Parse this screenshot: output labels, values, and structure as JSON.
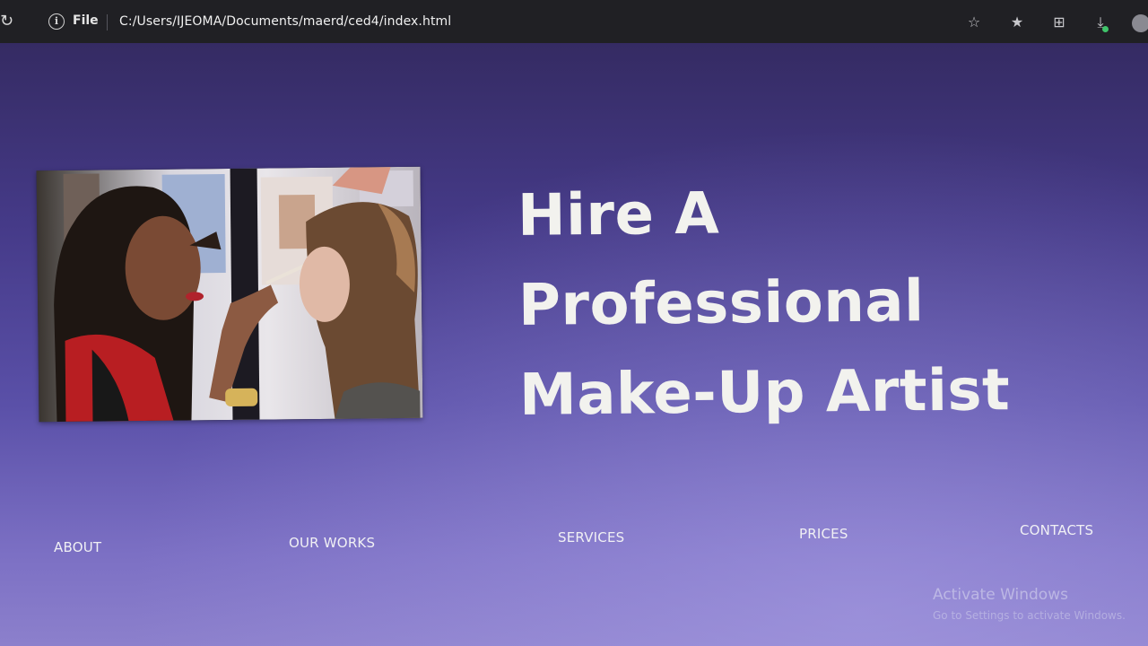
{
  "browser": {
    "file_label": "File",
    "url": "C:/Users/IJEOMA/Documents/maerd/ced4/index.html",
    "info_glyph": "i",
    "icons": [
      "reload-icon",
      "site-info-icon",
      "add-favorite-icon",
      "favorites-icon",
      "collections-icon",
      "downloads-icon",
      "profile-avatar"
    ]
  },
  "hero": {
    "title_line1": "Hire A",
    "title_line2": "Professional",
    "title_line3": "Make-Up Artist",
    "photo_alt": "Makeup artist applying makeup to a client"
  },
  "nav": {
    "about": "ABOUT",
    "our_works": "OUR WORKS",
    "services": "SERVICES",
    "prices": "PRICES",
    "contacts": "CONTACTS"
  },
  "watermark": {
    "title": "Activate Windows",
    "subtitle": "Go to Settings to activate Windows."
  },
  "colors": {
    "background_top": "#352b63",
    "background_bottom": "#8c80cc",
    "title": "#f2f2ee",
    "nav_text": "#f0f0f4"
  }
}
